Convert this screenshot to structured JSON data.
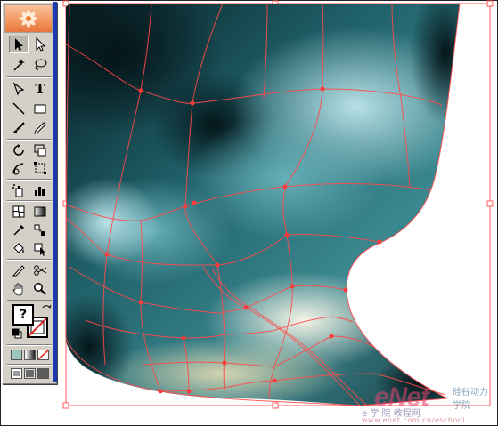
{
  "app": {
    "name": "Adobe Illustrator",
    "panel": "tools-palette"
  },
  "tools": [
    {
      "id": "selection",
      "icon": "selection-arrow-icon",
      "selected": true
    },
    {
      "id": "direct-selection",
      "icon": "direct-selection-icon"
    },
    {
      "id": "magic-wand",
      "icon": "magic-wand-icon"
    },
    {
      "id": "lasso",
      "icon": "lasso-icon"
    },
    {
      "id": "pen",
      "icon": "pen-icon"
    },
    {
      "id": "type",
      "icon": "type-tool-icon",
      "glyph": "T"
    },
    {
      "id": "line",
      "icon": "line-segment-icon"
    },
    {
      "id": "rectangle",
      "icon": "rectangle-icon"
    },
    {
      "id": "paintbrush",
      "icon": "paintbrush-icon"
    },
    {
      "id": "pencil",
      "icon": "pencil-icon"
    },
    {
      "id": "rotate",
      "icon": "rotate-icon"
    },
    {
      "id": "scale",
      "icon": "scale-icon"
    },
    {
      "id": "warp",
      "icon": "warp-icon"
    },
    {
      "id": "free-transform",
      "icon": "free-transform-icon"
    },
    {
      "id": "symbol-sprayer",
      "icon": "symbol-sprayer-icon"
    },
    {
      "id": "column-graph",
      "icon": "column-graph-icon"
    },
    {
      "id": "mesh",
      "icon": "mesh-icon"
    },
    {
      "id": "gradient",
      "icon": "gradient-icon"
    },
    {
      "id": "eyedropper",
      "icon": "eyedropper-icon"
    },
    {
      "id": "blend",
      "icon": "blend-icon"
    },
    {
      "id": "live-paint-bucket",
      "icon": "live-paint-bucket-icon"
    },
    {
      "id": "live-paint-selection",
      "icon": "live-paint-selection-icon"
    },
    {
      "id": "slice",
      "icon": "slice-icon"
    },
    {
      "id": "scissors",
      "icon": "scissors-icon"
    },
    {
      "id": "hand",
      "icon": "hand-icon"
    },
    {
      "id": "zoom",
      "icon": "zoom-icon"
    }
  ],
  "fill_stroke": {
    "fill_label": "?",
    "fill_icon": "fill-unknown-icon",
    "stroke_icon": "stroke-none-icon",
    "swap_icon": "swap-fill-stroke-icon",
    "default_icon": "default-fill-stroke-icon"
  },
  "color_modes": [
    "color-mode-icon",
    "gradient-mode-icon",
    "none-mode-icon"
  ],
  "screen_modes": [
    "standard-screen-mode-icon",
    "full-screen-menu-mode-icon",
    "full-screen-mode-icon"
  ],
  "colors": {
    "mesh_line": "#ff4a4a",
    "art_dark": "#08222a",
    "art_mid": "#2d7c86",
    "art_light": "#9fd4dc",
    "art_highlight": "#eef4e6",
    "toolbox_bg": "#d4d0c8",
    "toolbox_accent": "#1d3bb0"
  },
  "watermark": {
    "brand": "eNet",
    "chinese": "硅谷动力 学院",
    "sub": "e 学 院 教程网",
    "url": "www.enet.com.cn/eschool"
  }
}
